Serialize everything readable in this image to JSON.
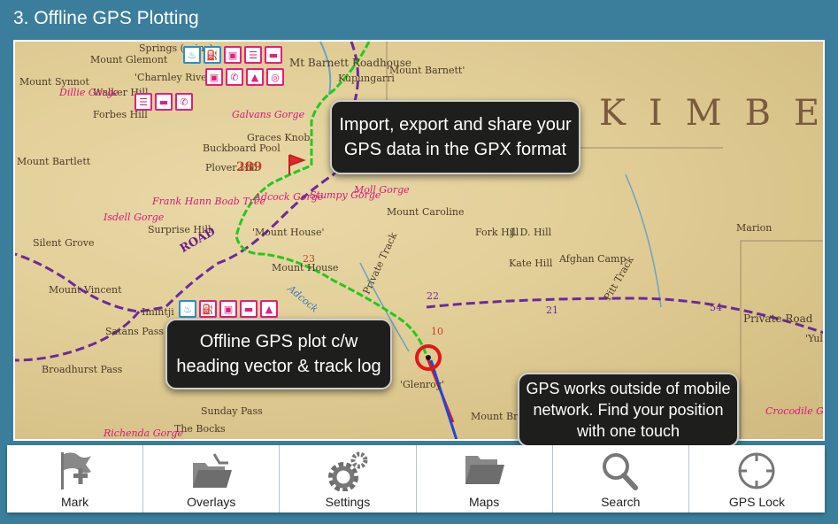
{
  "title": "3. Offline GPS Plotting",
  "map": {
    "region_label": "KIMBE",
    "labels": [
      "Mount Glemont",
      "Mount Synnot",
      "'Charnley River'",
      "Walker Hill",
      "Dillie Gorge",
      "Forbes Hill",
      "Springs (ruins)",
      "Mt Barnett Roadhouse",
      "'Mount Barnett'",
      "Kupungarri",
      "Galvans Gorge",
      "Graces Knob",
      "Buckboard Pool",
      "Plover Hill",
      "Mount Bartlett",
      "Frank Hann Boab Tree",
      "Adcock Gorge",
      "Stumpy Gorge",
      "Moll Gorge",
      "Mount Caroline",
      "'Mount House'",
      "Mount House",
      "Isdell Gorge",
      "Surprise Hill",
      "Silent Grove",
      "Mount Vincent",
      "Imintji",
      "Satans Pass",
      "Broadhurst Pass",
      "Sunday Pass",
      "The Bocks",
      "Richenda Gorge",
      "'Glenroy'",
      "Mount Brennan",
      "Fork Hill",
      "J. D. Hill",
      "Kate Hill",
      "Afghan Camp",
      "Marion",
      "Private Road",
      "'Yul (Tal)'",
      "Crocodile Gorge",
      "Private Track",
      "Pitt Track",
      "Adcock",
      "ROAD",
      "289",
      "22",
      "23",
      "21",
      "54",
      "10"
    ],
    "track_color": "#22c81e",
    "route_color": "#6a2a9a",
    "heading_color": "#e01818"
  },
  "callouts": {
    "import": "Import, export and share your GPS data in the GPX format",
    "plot": "Offline GPS plot c/w heading vector & track log",
    "network": "GPS works outside of mobile network. Find your position with one touch"
  },
  "toolbar": [
    {
      "label": "Mark",
      "icon": "flag-plus-icon"
    },
    {
      "label": "Overlays",
      "icon": "folder-pin-icon"
    },
    {
      "label": "Settings",
      "icon": "gears-icon"
    },
    {
      "label": "Maps",
      "icon": "folder-icon"
    },
    {
      "label": "Search",
      "icon": "magnifier-icon"
    },
    {
      "label": "GPS Lock",
      "icon": "crosshair-icon"
    }
  ]
}
